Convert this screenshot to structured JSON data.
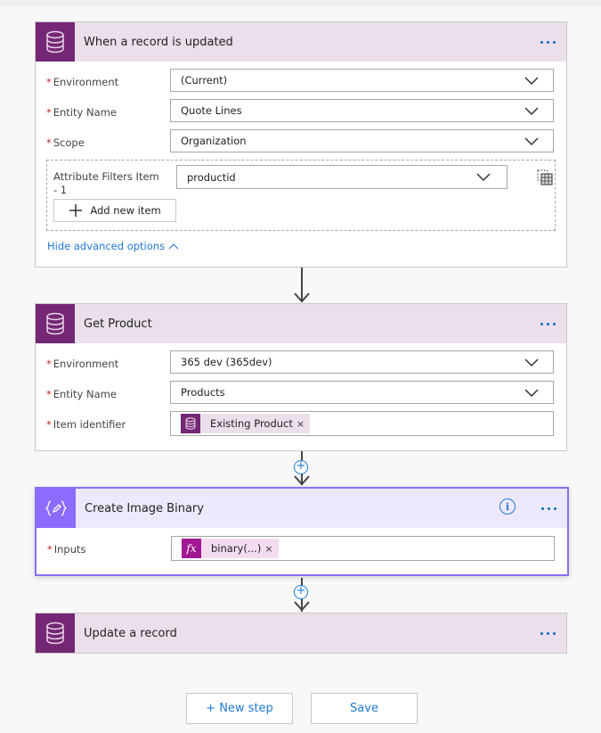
{
  "colors": {
    "cds_brand": "#742774",
    "compose_brand": "#8c6cff",
    "link": "#1e7ad6",
    "required": "#c4262e",
    "selected_border": "#8b6ef5"
  },
  "trigger": {
    "title": "When a record is updated",
    "icon": "database-icon",
    "fields": [
      {
        "label": "Environment",
        "required": true,
        "value": "(Current)"
      },
      {
        "label": "Entity Name",
        "required": true,
        "value": "Quote Lines"
      },
      {
        "label": "Scope",
        "required": true,
        "value": "Organization"
      }
    ],
    "advanced": {
      "label": "Attribute Filters Item - 1",
      "value": "productid",
      "add_item_label": "Add new item"
    },
    "hide_advanced_label": "Hide advanced options"
  },
  "get_product": {
    "title": "Get Product",
    "icon": "database-icon",
    "fields": [
      {
        "label": "Environment",
        "required": true,
        "value": "365 dev (365dev)"
      },
      {
        "label": "Entity Name",
        "required": true,
        "value": "Products"
      },
      {
        "label": "Item identifier",
        "required": true,
        "token": "Existing Product"
      }
    ]
  },
  "compose": {
    "title": "Create Image Binary",
    "icon": "compose-icon",
    "fields": [
      {
        "label": "Inputs",
        "required": true,
        "token": "binary(...)",
        "token_icon": "fx"
      }
    ]
  },
  "update": {
    "title": "Update a record",
    "icon": "database-icon"
  },
  "footer": {
    "new_step_label": "+ New step",
    "save_label": "Save"
  },
  "glyphs": {
    "required": "*",
    "remove": "×",
    "plus": "+",
    "info": "i",
    "fx": "fx"
  }
}
